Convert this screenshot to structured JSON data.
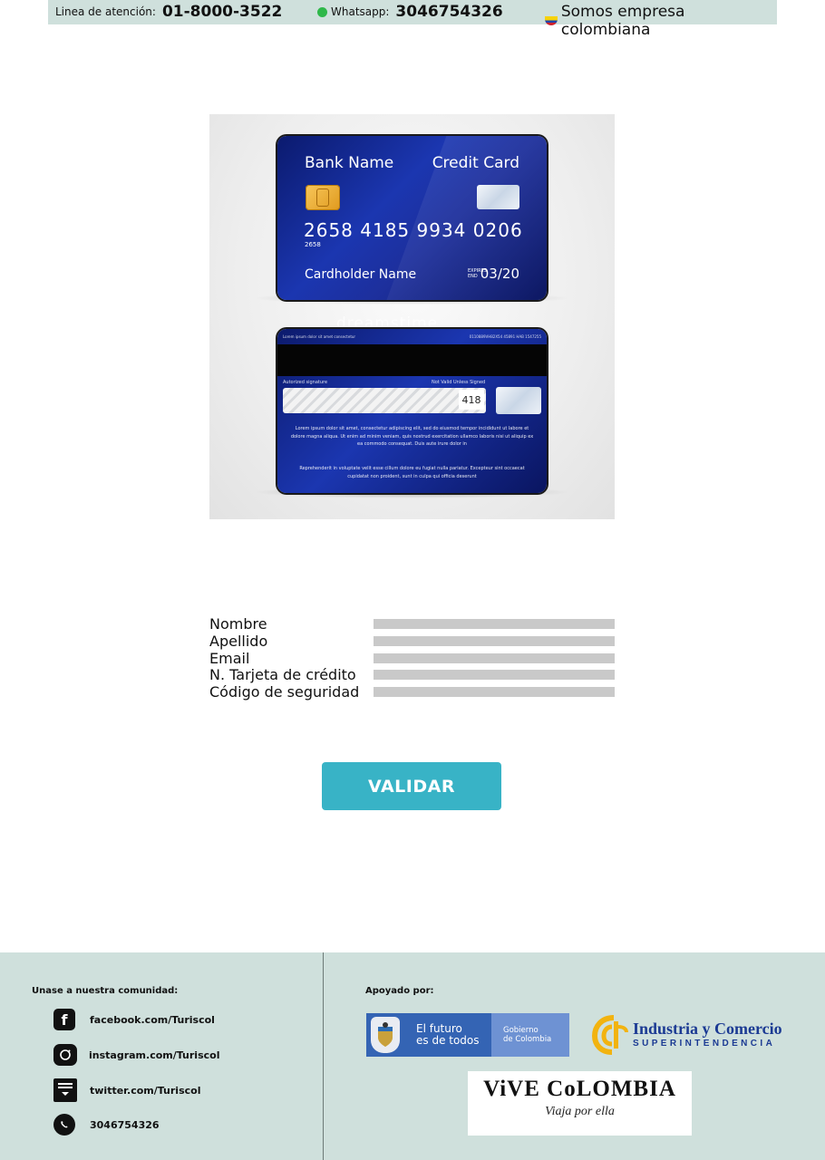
{
  "topbar": {
    "line_label": "Linea de atención:",
    "line_number": "01-8000-3522",
    "whatsapp_label": "Whatsapp:",
    "whatsapp_number": "3046754326",
    "company_text": "Somos empresa colombiana"
  },
  "card_image": {
    "front": {
      "bank_name": "Bank Name",
      "card_type": "Credit Card",
      "number": "2658  4185  9934  0206",
      "small_number": "2658",
      "holder": "Cardholder Name",
      "expires_label": "EXPIRES END",
      "expiry": "03/20"
    },
    "back": {
      "top_left": "Lorem ipsum dolor sit amet consectetur",
      "top_right": "0110889VH82X54 45891 HAB 1547255",
      "signature_label": "Autorized signature",
      "not_valid_label": "Not Valid Unless Signed",
      "cvv": "418",
      "legal_text": "Lorem ipsum dolor sit amet, consectetur adipiscing elit, sed do eiusmod tempor incididunt ut labore et dolore magna aliqua. Ut enim ad minim veniam, quis nostrud exercitation ullamco laboris nisi ut aliquip ex ea commodo consequat. Duis aute irure dolor in",
      "legal_text_2": "Reprehenderit in voluptate velit esse cillum dolore eu fugiat nulla pariatur. Excepteur sint occaecat cupidatat non proident, sunt in culpa qui officia deserunt"
    },
    "watermark": "dreamstime"
  },
  "form": {
    "fields": [
      {
        "label": "Nombre",
        "value": ""
      },
      {
        "label": "Apellido",
        "value": ""
      },
      {
        "label": "Email",
        "value": ""
      },
      {
        "label": "N. Tarjeta de crédito",
        "value": ""
      },
      {
        "label": "Código de seguridad",
        "value": ""
      }
    ],
    "submit_label": "VALIDAR"
  },
  "footer": {
    "community_heading": "Unase a nuestra comunidad:",
    "social": [
      {
        "icon": "facebook-icon",
        "text": "facebook.com/Turiscol"
      },
      {
        "icon": "instagram-icon",
        "text": "instagram.com/Turiscol"
      },
      {
        "icon": "twitter-icon",
        "text": "twitter.com/Turiscol"
      },
      {
        "icon": "whatsapp-icon",
        "text": "3046754326"
      }
    ],
    "support_heading": "Apoyado por:",
    "gov_logo": {
      "line1": "El futuro",
      "line2": "es de todos",
      "line3": "Gobierno",
      "line4": "de Colombia"
    },
    "sic_logo": {
      "title": "Industria y Comercio",
      "subtitle": "SUPERINTENDENCIA"
    },
    "vive_logo": {
      "title": "ViVE CoLOMBIA",
      "subtitle": "Viaja por ella"
    }
  },
  "colors": {
    "topbar_bg": "#cfe0dc",
    "footer_bg": "#cfe0dc",
    "button_bg": "#38b3c6",
    "input_bg": "#c9c9c9"
  }
}
